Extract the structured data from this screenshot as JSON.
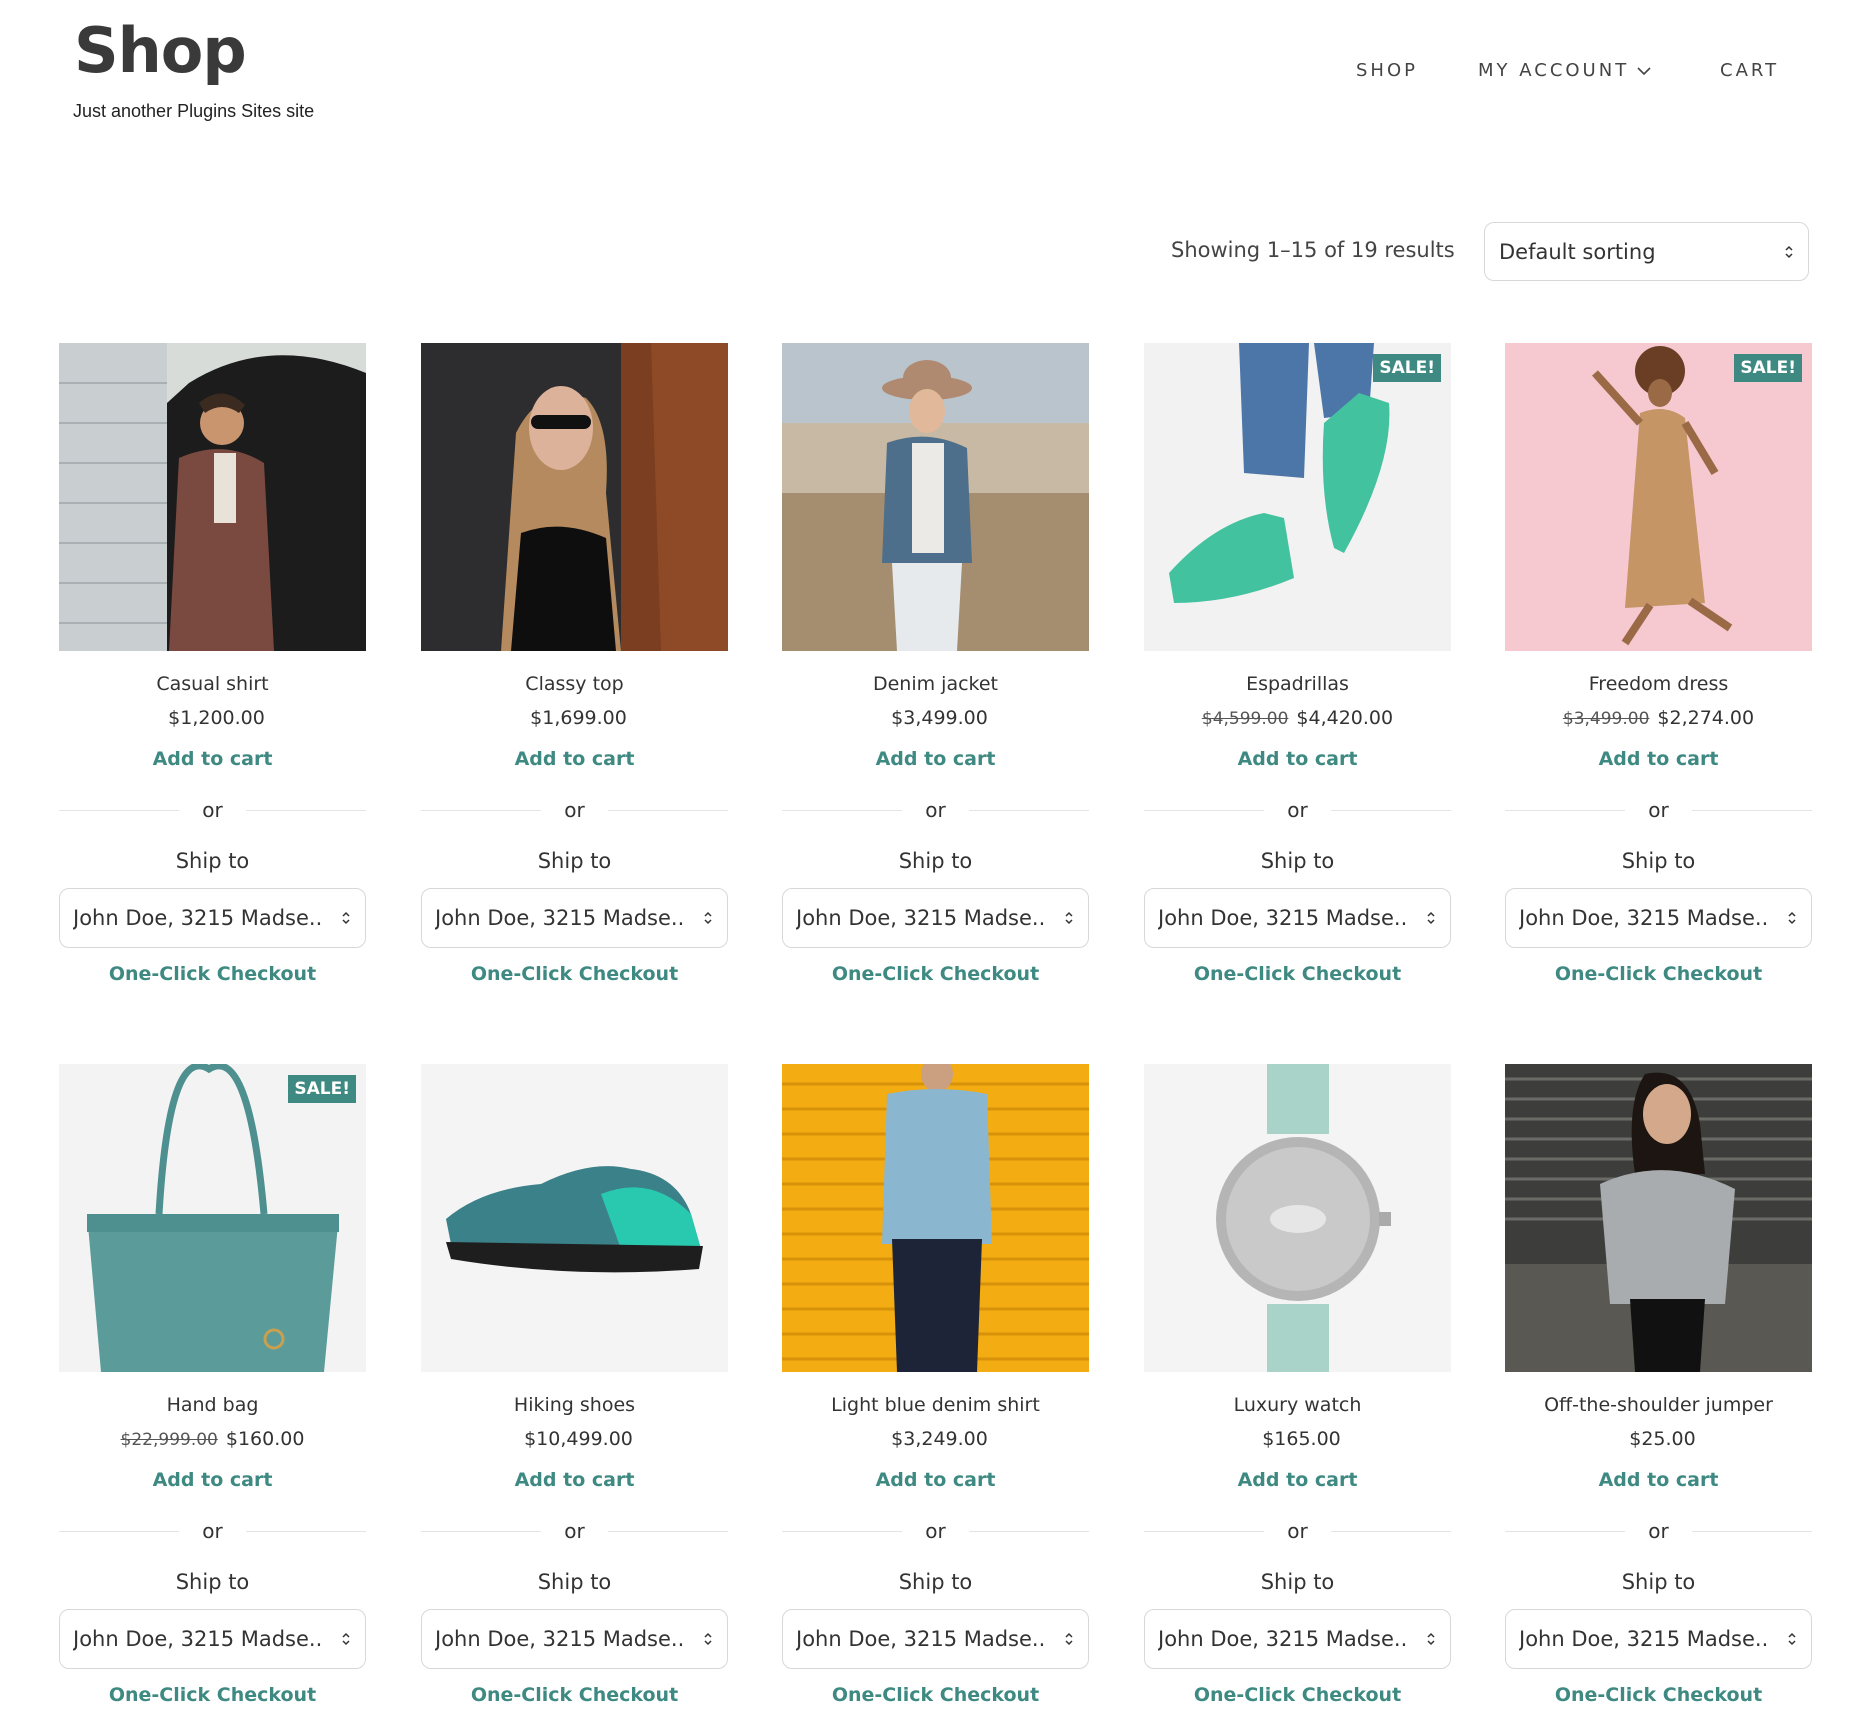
{
  "site": {
    "title": "Shop",
    "tagline": "Just another Plugins Sites site"
  },
  "nav": {
    "shop": "SHOP",
    "my_account": "MY ACCOUNT",
    "cart": "CART"
  },
  "toolbar": {
    "result_count": "Showing 1–15 of 19 results",
    "sort_value": "Default sorting"
  },
  "colors": {
    "accent": "#3e8a82",
    "badge": "#3e8a82"
  },
  "labels": {
    "add_to_cart": "Add to cart",
    "or": "or",
    "ship_to": "Ship to",
    "one_click": "One-Click Checkout",
    "sale": "SALE!",
    "ship_address": "John Doe, 3215 Madse..."
  },
  "products": [
    {
      "name": "Casual shirt",
      "price": "$1,200.00",
      "old_price": "",
      "sale": false
    },
    {
      "name": "Classy top",
      "price": "$1,699.00",
      "old_price": "",
      "sale": false
    },
    {
      "name": "Denim jacket",
      "price": "$3,499.00",
      "old_price": "",
      "sale": false
    },
    {
      "name": "Espadrillas",
      "price": "$4,420.00",
      "old_price": "$4,599.00",
      "sale": true
    },
    {
      "name": "Freedom dress",
      "price": "$2,274.00",
      "old_price": "$3,499.00",
      "sale": true
    },
    {
      "name": "Hand bag",
      "price": "$160.00",
      "old_price": "$22,999.00",
      "sale": true
    },
    {
      "name": "Hiking shoes",
      "price": "$10,499.00",
      "old_price": "",
      "sale": false
    },
    {
      "name": "Light blue denim shirt",
      "price": "$3,249.00",
      "old_price": "",
      "sale": false
    },
    {
      "name": "Luxury watch",
      "price": "$165.00",
      "old_price": "",
      "sale": false
    },
    {
      "name": "Off-the-shoulder jumper",
      "price": "$25.00",
      "old_price": "",
      "sale": false
    }
  ]
}
